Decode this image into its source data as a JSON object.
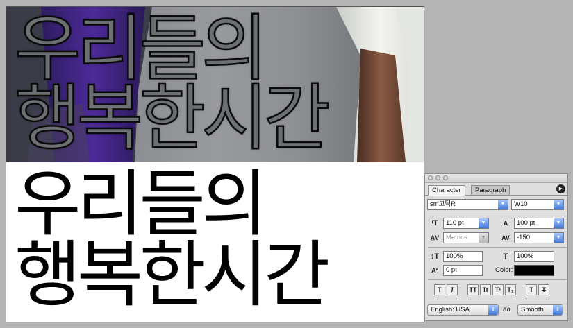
{
  "canvas": {
    "text_line1": "우리들의",
    "text_line2": "행복한시간"
  },
  "palette": {
    "tabs": [
      "Character",
      "Paragraph"
    ],
    "menu_icon": "triangle-right",
    "font_family": "sm고딕R",
    "font_style": "W10",
    "font_size": "110 pt",
    "leading": "100 pt",
    "kerning": "Metrics",
    "tracking": "-150",
    "vertical_scale": "100%",
    "horizontal_scale": "100%",
    "baseline_shift": "0 pt",
    "color_label": "Color:",
    "color_value": "#000000",
    "style_buttons": [
      "T",
      "T",
      "TT",
      "Tr",
      "T¹",
      "T₁",
      "T",
      "T"
    ],
    "language": "English: USA",
    "antialias_icon": "aa",
    "antialias": "Smooth"
  }
}
